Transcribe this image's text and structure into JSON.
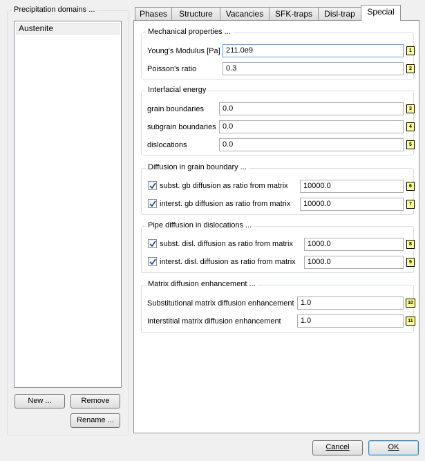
{
  "left": {
    "title": "Precipitation domains ...",
    "items": [
      "Austenite"
    ],
    "new_button": "New ...",
    "remove_button": "Remove",
    "rename_button": "Rename ..."
  },
  "tabs": [
    "Phases",
    "Structure",
    "Vacancies",
    "SFK-traps",
    "Disl-trap",
    "Special"
  ],
  "active_tab": "Special",
  "mechanical": {
    "title": "Mechanical properties ...",
    "youngs_label": "Young's Modulus [Pa]",
    "youngs_value": "211.0e9",
    "poisson_label": "Poisson's ratio",
    "poisson_value": "0.3"
  },
  "interfacial": {
    "title": "Interfacial energy",
    "gb_label": "grain boundaries",
    "gb_value": "0.0",
    "sgb_label": "subgrain boundaries",
    "sgb_value": "0.0",
    "disl_label": "dislocations",
    "disl_value": "0.0"
  },
  "gb_diffusion": {
    "title": "Diffusion in grain boundary ...",
    "subst_label": "subst. gb diffusion as ratio from matrix",
    "subst_value": "10000.0",
    "subst_checked": true,
    "interst_label": "interst. gb diffusion as ratio from matrix",
    "interst_value": "10000.0",
    "interst_checked": true
  },
  "pipe_diffusion": {
    "title": "Pipe diffusion in dislocations ...",
    "subst_label": "subst. disl. diffusion as ratio from matrix",
    "subst_value": "1000.0",
    "subst_checked": true,
    "interst_label": "interst. disl. diffusion as ratio from matrix",
    "interst_value": "1000.0",
    "interst_checked": true
  },
  "matrix": {
    "title": "Matrix diffusion enhancement  ...",
    "subst_label": "Substitutional matrix diffusion enhancement",
    "subst_value": "1.0",
    "interst_label": "Interstitial matrix diffusion enhancement",
    "interst_value": "1.0"
  },
  "badges": [
    "1",
    "2",
    "3",
    "4",
    "5",
    "6",
    "7",
    "8",
    "9",
    "10",
    "11"
  ],
  "footer": {
    "cancel_button": "Cancel",
    "ok_button": "OK"
  }
}
